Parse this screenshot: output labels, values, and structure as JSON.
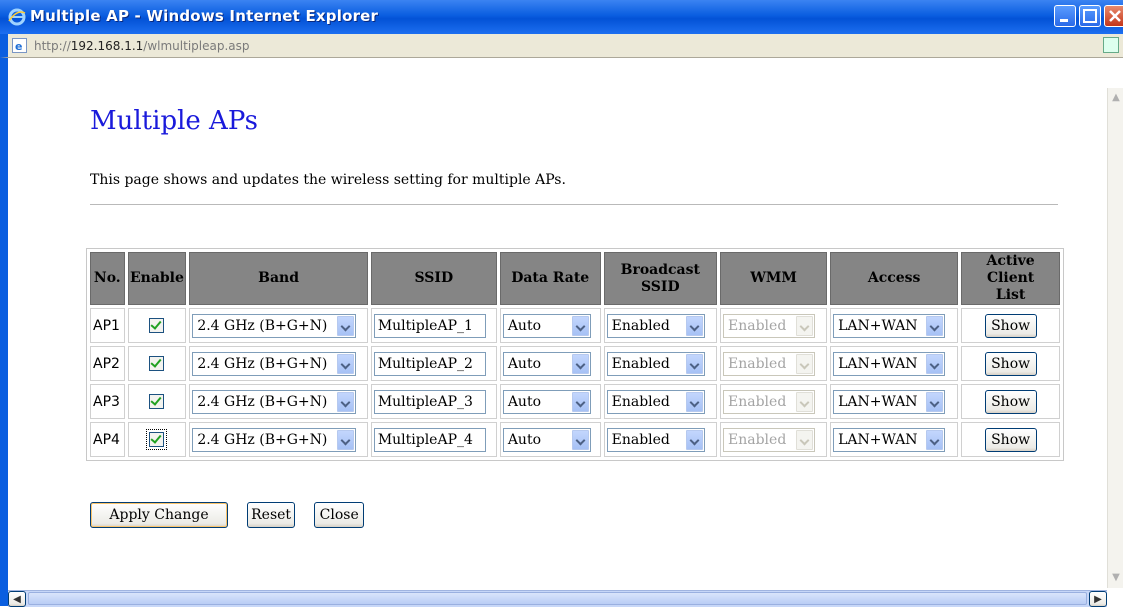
{
  "window": {
    "title": "Multiple AP - Windows Internet Explorer"
  },
  "address": {
    "prefix": "http://",
    "host": "192.168.1.1",
    "path": "/wlmultipleap.asp"
  },
  "page": {
    "title": "Multiple APs",
    "description": "This page shows and updates the wireless setting for multiple APs."
  },
  "table": {
    "headers": [
      "No.",
      "Enable",
      "Band",
      "SSID",
      "Data Rate",
      "Broadcast SSID",
      "WMM",
      "Access",
      "Active Client List"
    ],
    "rows": [
      {
        "no": "AP1",
        "enabled": true,
        "band": "2.4 GHz (B+G+N)",
        "ssid": "MultipleAP_1",
        "rate": "Auto",
        "broadcast": "Enabled",
        "wmm": "Enabled",
        "access": "LAN+WAN",
        "show": "Show"
      },
      {
        "no": "AP2",
        "enabled": true,
        "band": "2.4 GHz (B+G+N)",
        "ssid": "MultipleAP_2",
        "rate": "Auto",
        "broadcast": "Enabled",
        "wmm": "Enabled",
        "access": "LAN+WAN",
        "show": "Show"
      },
      {
        "no": "AP3",
        "enabled": true,
        "band": "2.4 GHz (B+G+N)",
        "ssid": "MultipleAP_3",
        "rate": "Auto",
        "broadcast": "Enabled",
        "wmm": "Enabled",
        "access": "LAN+WAN",
        "show": "Show"
      },
      {
        "no": "AP4",
        "enabled": true,
        "band": "2.4 GHz (B+G+N)",
        "ssid": "MultipleAP_4",
        "rate": "Auto",
        "broadcast": "Enabled",
        "wmm": "Enabled",
        "access": "LAN+WAN",
        "show": "Show"
      }
    ]
  },
  "buttons": {
    "apply": "Apply Change",
    "reset": "Reset",
    "close": "Close"
  },
  "colors": {
    "title_blue": "#1a1adb",
    "header_gray": "#858585",
    "titlebar_blue": "#0a5ee0"
  },
  "icons": {
    "browser": "ie-icon",
    "page": "page-icon"
  }
}
